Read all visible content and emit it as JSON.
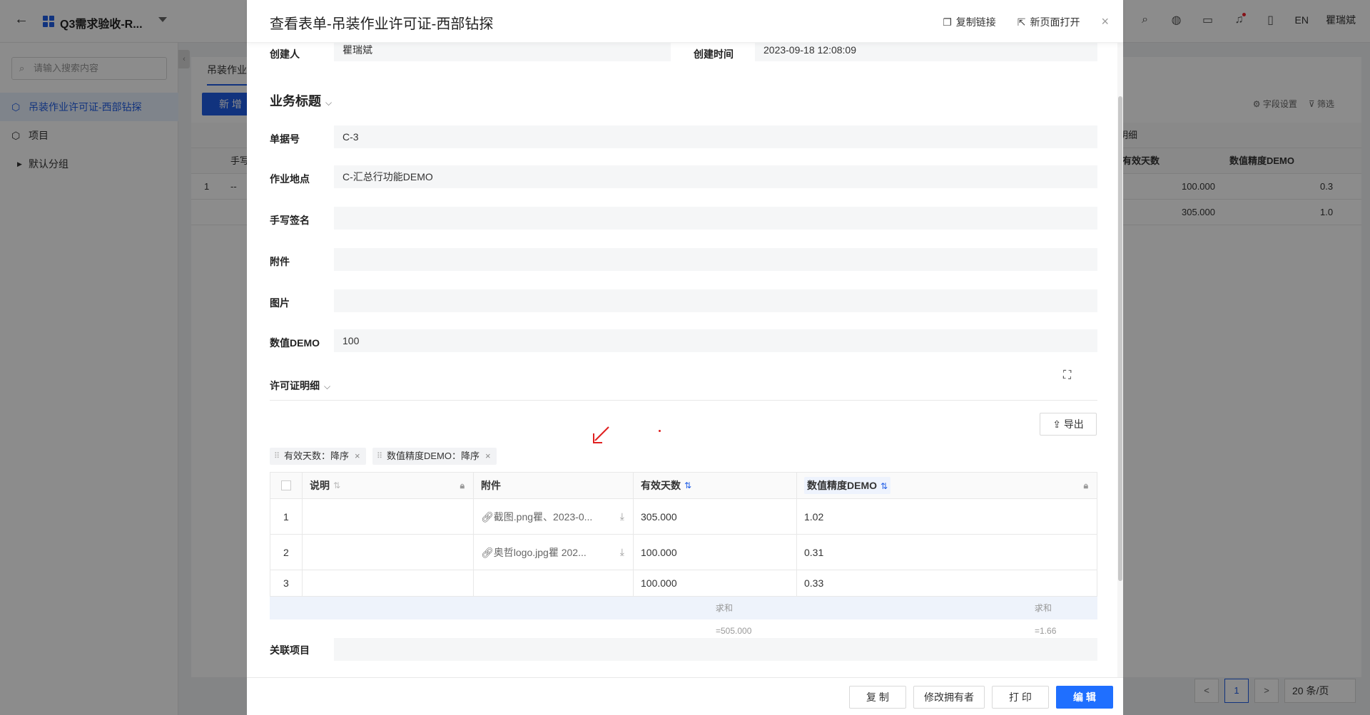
{
  "app": {
    "title": "Q3需求验收-R...",
    "top_right": {
      "lang": "EN",
      "user": "瞿瑞斌"
    }
  },
  "sidebar": {
    "search_placeholder": "请输入搜索内容",
    "items": [
      {
        "label": "吊装作业许可证-西部钻探"
      },
      {
        "label": "项目"
      },
      {
        "label": "默认分组"
      }
    ],
    "collapse_icon": "‹"
  },
  "background": {
    "tab": "吊装作业",
    "new_button": "新 增",
    "toolbar": {
      "fields": "字段设置",
      "filter": "筛选"
    },
    "table": {
      "col_handwrite": "手写",
      "col_detail": "明细",
      "col_days": "有效天数",
      "col_precision": "数值精度DEMO",
      "rows": [
        {
          "index": "1",
          "first": "--",
          "days": "100.000",
          "precision": "0.3"
        },
        {
          "index": "",
          "first": "",
          "days": "305.000",
          "precision": "1.0"
        }
      ]
    },
    "pager": {
      "prev": "<",
      "page": "1",
      "next": ">",
      "size": "20 条/页"
    }
  },
  "modal": {
    "title": "查看表单-吊装作业许可证-西部钻探",
    "copy_link": "复制链接",
    "open_new": "新页面打开",
    "close": "×",
    "fields": {
      "creator_label": "创建人",
      "creator_value": "瞿瑞斌",
      "created_time_label": "创建时间",
      "created_time_value": "2023-09-18 12:08:09"
    },
    "section_business": "业务标题",
    "business_fields": [
      {
        "label": "单据号",
        "value": "C-3"
      },
      {
        "label": "作业地点",
        "value": "C-汇总行功能DEMO"
      },
      {
        "label": "手写签名",
        "value": ""
      },
      {
        "label": "附件",
        "value": ""
      },
      {
        "label": "图片",
        "value": ""
      },
      {
        "label": "数值DEMO",
        "value": "100"
      }
    ],
    "detail_section": "许可证明细",
    "export_label": "导出",
    "sort_tags": [
      {
        "label": "有效天数：降序"
      },
      {
        "label": "数值精度DEMO：降序"
      }
    ],
    "detail_table": {
      "headers": {
        "desc": "说明",
        "attach": "附件",
        "days": "有效天数",
        "precision": "数值精度DEMO"
      },
      "rows": [
        {
          "index": "1",
          "desc": "",
          "attach": "截图.png瞿、2023-0...",
          "days": "305.000",
          "precision": "1.02"
        },
        {
          "index": "2",
          "desc": "",
          "attach": "奥哲logo.jpg瞿 202...",
          "days": "100.000",
          "precision": "0.31"
        },
        {
          "index": "3",
          "desc": "",
          "attach": "",
          "days": "100.000",
          "precision": "0.33"
        }
      ],
      "sum_days": "求和=505.000",
      "sum_precision": "求和=1.66"
    },
    "related_label": "关联项目",
    "related_value": "",
    "footer": {
      "copy": "复 制",
      "change_owner": "修改拥有者",
      "print": "打 印",
      "edit": "编 辑"
    }
  }
}
